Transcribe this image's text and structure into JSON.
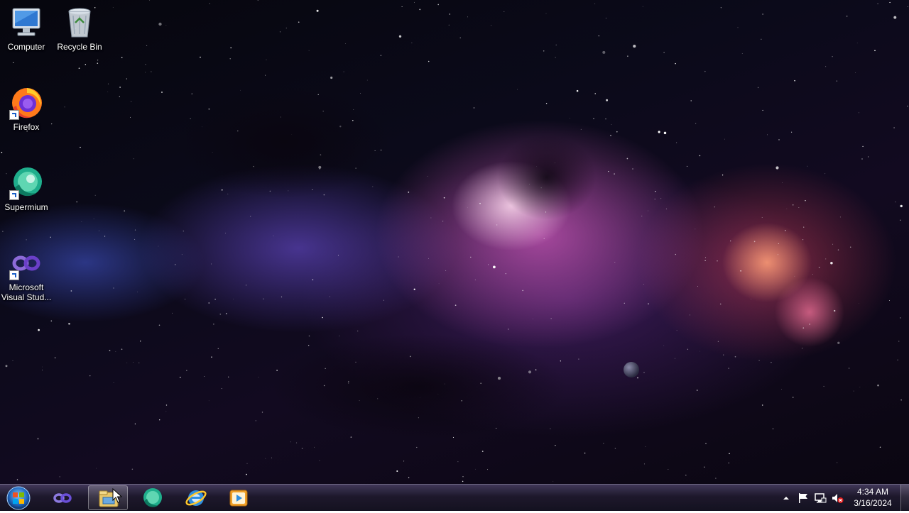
{
  "desktop": {
    "icons": [
      {
        "label": "Computer",
        "icon": "computer-icon"
      },
      {
        "label": "Recycle Bin",
        "icon": "recycle-bin-icon"
      },
      {
        "label": "Firefox",
        "icon": "firefox-icon"
      },
      {
        "label": "Supermium",
        "icon": "supermium-icon"
      },
      {
        "label": "Microsoft Visual Stud...",
        "icon": "visual-studio-icon"
      }
    ]
  },
  "taskbar": {
    "pinned": [
      {
        "name": "Visual Studio",
        "icon": "visual-studio-icon"
      },
      {
        "name": "Windows Explorer",
        "icon": "file-explorer-icon"
      },
      {
        "name": "Supermium",
        "icon": "supermium-icon"
      },
      {
        "name": "Internet Explorer",
        "icon": "internet-explorer-icon"
      },
      {
        "name": "Windows Media Player",
        "icon": "media-player-icon"
      }
    ],
    "tray": {
      "icons": [
        "show-hidden-icons-icon",
        "action-center-flag-icon",
        "network-icon",
        "volume-muted-icon"
      ]
    },
    "clock": {
      "time": "4:34 AM",
      "date": "3/16/2024"
    }
  },
  "colors": {
    "taskbar": "#1e1a2c",
    "nebula_pink": "#d25abe",
    "nebula_blue": "#5a5adc"
  }
}
